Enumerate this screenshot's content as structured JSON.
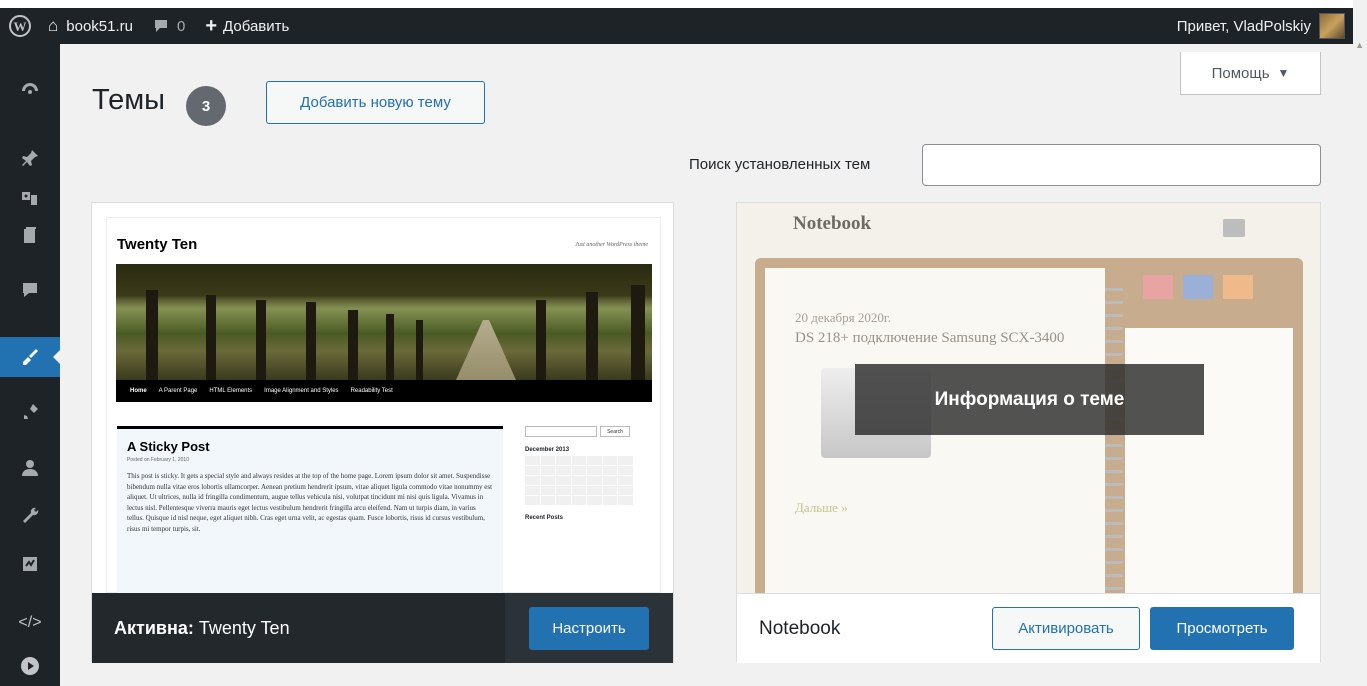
{
  "adminbar": {
    "site_name": "book51.ru",
    "comments_count": "0",
    "add_label": "Добавить",
    "greeting": "Привет, VladPolskiy"
  },
  "help": {
    "label": "Помощь",
    "arrow": "▼"
  },
  "page": {
    "title": "Темы",
    "count": "3",
    "add_new_label": "Добавить новую тему",
    "search_label": "Поиск установленных тем",
    "search_value": ""
  },
  "sidebar": {
    "icons": [
      "dashboard-icon",
      "pin-icon",
      "media-icon",
      "pages-icon",
      "comments-icon",
      "appearance-icon",
      "plugins-icon",
      "users-icon",
      "tools-icon",
      "settings-icon",
      "code-icon",
      "play-icon"
    ]
  },
  "themes": [
    {
      "active_prefix": "Активна:",
      "name": "Twenty Ten",
      "customize_label": "Настроить",
      "preview": {
        "site_title": "Twenty Ten",
        "description": "Just another WordPress theme",
        "menu": [
          "Home",
          "A Parent Page",
          "HTML Elements",
          "Image Alignment and Styles",
          "Readability Test"
        ],
        "post_title": "A Sticky Post",
        "post_meta": "Posted on February 1, 2010",
        "post_text": "This post is sticky. It gets a special style and always resides at the top of the home page. Lorem ipsum dolor sit amet. Suspendisse bibendum nulla vitae eros lobortis ullamcorper. Aenean pretium hendrerit ipsum, vitae aliquet ligula commodo vitae nonummy est aliquet. Ut ultrices, nulla id fringilla condimentum, augue tellus vehicula nisi, volutpat tincidunt mi nisi quis ligula. Vivamus in lectus nisl. Pellentesque viverra mauris eget lectus vestibulum hendrerit fringilla arcu eleifend. Nam ut turpis diam, in varius tellus. Quisque id nisl neque, eget aliquet nibh. Cras eget urna velit, ac egestas quam. Fusce lobortis, risus id cursus vestibulum, risus mi tempor turpis, sit.",
        "search_btn": "Search",
        "calendar_title": "December 2013",
        "recent_posts": "Recent Posts"
      }
    },
    {
      "name": "Notebook",
      "details_label": "Информация о теме",
      "activate_label": "Активировать",
      "preview_label": "Просмотреть",
      "preview": {
        "logo": "Notebook",
        "date": "20 декабря 2020г.",
        "post_title": "DS 218+ подключение Samsung SCX-3400",
        "more": "Дальше »"
      }
    }
  ],
  "colors": {
    "admin_dark": "#1d2327",
    "accent": "#2271b1",
    "background": "#f1f1f1"
  }
}
